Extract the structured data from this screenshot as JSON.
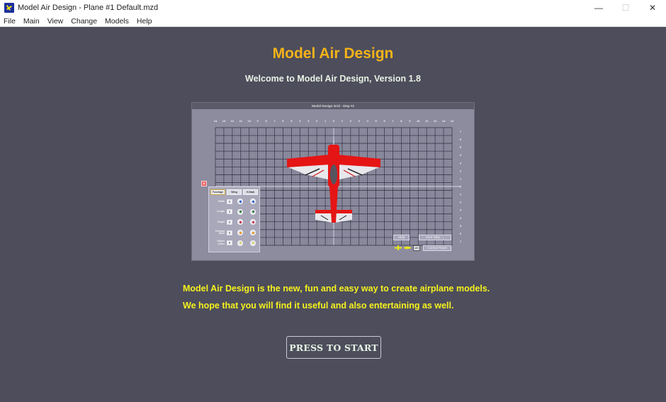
{
  "window": {
    "title": "Model Air Design - Plane #1  Default.mzd",
    "controls": {
      "minimize": "—",
      "maximize": "☐",
      "close": "✕"
    }
  },
  "menu": [
    "File",
    "Main",
    "View",
    "Change",
    "Models",
    "Help"
  ],
  "header": {
    "title": "Model Air Design",
    "subtitle": "Welcome to Model Air Design, Version 1.8"
  },
  "preview": {
    "titlebar": "Model Design Grid  -  Step #2",
    "top_axis": [
      "14",
      "13",
      "12",
      "11",
      "10",
      "9",
      "8",
      "7",
      "6",
      "5",
      "4",
      "3",
      "2",
      "1",
      "0",
      "1",
      "2",
      "3",
      "4",
      "5",
      "6",
      "7",
      "8",
      "9",
      "10",
      "11",
      "12",
      "13",
      "14"
    ],
    "right_axis": [
      "7",
      "6",
      "5",
      "4",
      "3",
      "2",
      "1",
      "0",
      "1",
      "2",
      "3",
      "4",
      "5",
      "6",
      "7"
    ],
    "panel": {
      "tabs": [
        "Fuselage",
        "Wing",
        "H.Stab"
      ],
      "active_tab": "Fuselage",
      "rows": [
        {
          "label": "Width",
          "value": "0",
          "color": "#2b5fd0"
        },
        {
          "label": "Length",
          "value": "2",
          "color": "#2f7a3a"
        },
        {
          "label": "Height",
          "value": "0",
          "color": "#c43148"
        },
        {
          "label": "Forward Back",
          "value": "0",
          "color": "#e59418"
        },
        {
          "label": "Higher Lower",
          "value": "0",
          "color": "#d8d06a"
        }
      ]
    },
    "buttons": {
      "help": "Help",
      "next_step": "Next Step →",
      "cm": "cM",
      "control_panel": "Control Panel"
    }
  },
  "description": {
    "line1": "Model Air Design is the new, fun and easy way to create airplane models.",
    "line2": "We hope that you will find it useful and also entertaining as well."
  },
  "start_button": "PRESS TO START",
  "icons": {
    "app": "plane-logo-icon",
    "close_panel": "close-icon"
  }
}
